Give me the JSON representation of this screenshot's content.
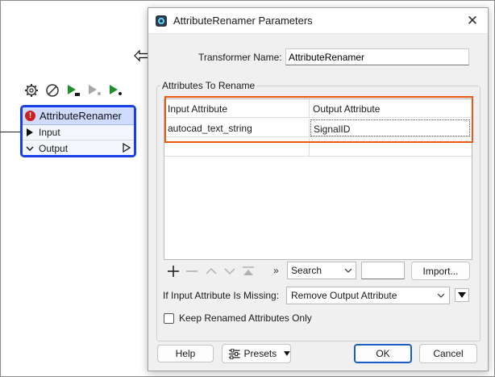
{
  "canvas": {
    "node": {
      "title": "AttributeRenamer",
      "ports": [
        {
          "label": "Input"
        },
        {
          "label": "Output"
        }
      ]
    },
    "toolbar_icons": [
      "gear-icon",
      "disable-icon",
      "run-icon",
      "run-disabled-icon",
      "run-next-icon"
    ]
  },
  "dialog": {
    "title": "AttributeRenamer Parameters",
    "transformer_name_label": "Transformer Name:",
    "transformer_name_value": "AttributeRenamer",
    "group_title": "Attributes To Rename",
    "table": {
      "headers": [
        "Input Attribute",
        "Output Attribute"
      ],
      "rows": [
        [
          "autocad_text_string",
          "SignalID"
        ],
        [
          "",
          ""
        ]
      ]
    },
    "search_label": "Search",
    "search_value": "",
    "import_label": "Import...",
    "missing_label": "If Input Attribute Is Missing:",
    "missing_value": "Remove Output Attribute",
    "keep_label": "Keep Renamed Attributes Only",
    "keep_checked": false,
    "help_label": "Help",
    "presets_label": "Presets",
    "ok_label": "OK",
    "cancel_label": "Cancel"
  },
  "colors": {
    "node_border": "#1a3ee8",
    "node_header": "#cfdcff",
    "highlight": "#ea5a17",
    "run_green": "#1f8f2e",
    "error_red": "#cc1f1f"
  }
}
